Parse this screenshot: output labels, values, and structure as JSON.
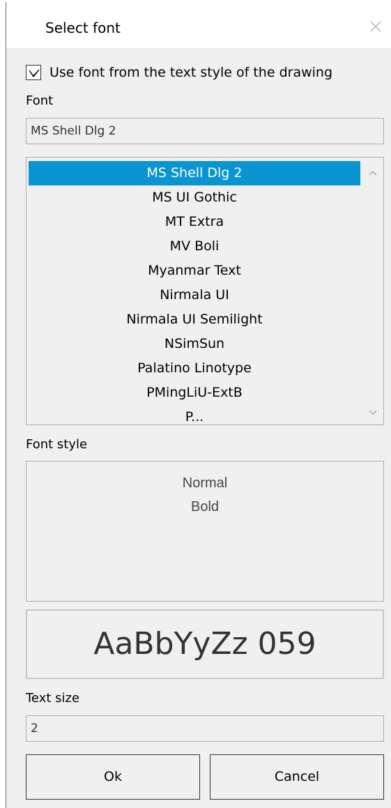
{
  "dialog": {
    "title": "Select font",
    "close_icon": "close-icon"
  },
  "use_style_font": {
    "checked": true,
    "label": "Use font from the text style of the drawing"
  },
  "font": {
    "label": "Font",
    "value": "MS Shell Dlg 2",
    "list": {
      "selected_index": 0,
      "items": [
        "MS Shell Dlg 2",
        "MS UI Gothic",
        "MT Extra",
        "MV Boli",
        "Myanmar Text",
        "Nirmala UI",
        "Nirmala UI Semilight",
        "NSimSun",
        "Palatino Linotype",
        "PMingLiU-ExtB",
        "P..."
      ]
    }
  },
  "font_style": {
    "label": "Font style",
    "items": [
      "Normal",
      "Bold"
    ]
  },
  "preview": {
    "sample_text": "AaBbYyZz 059"
  },
  "text_size": {
    "label": "Text size",
    "value": "2"
  },
  "buttons": {
    "ok": "Ok",
    "cancel": "Cancel"
  },
  "colors": {
    "selection": "#0a95d2",
    "window_bg": "#f0f0f0",
    "titlebar_bg": "#ffffff"
  }
}
